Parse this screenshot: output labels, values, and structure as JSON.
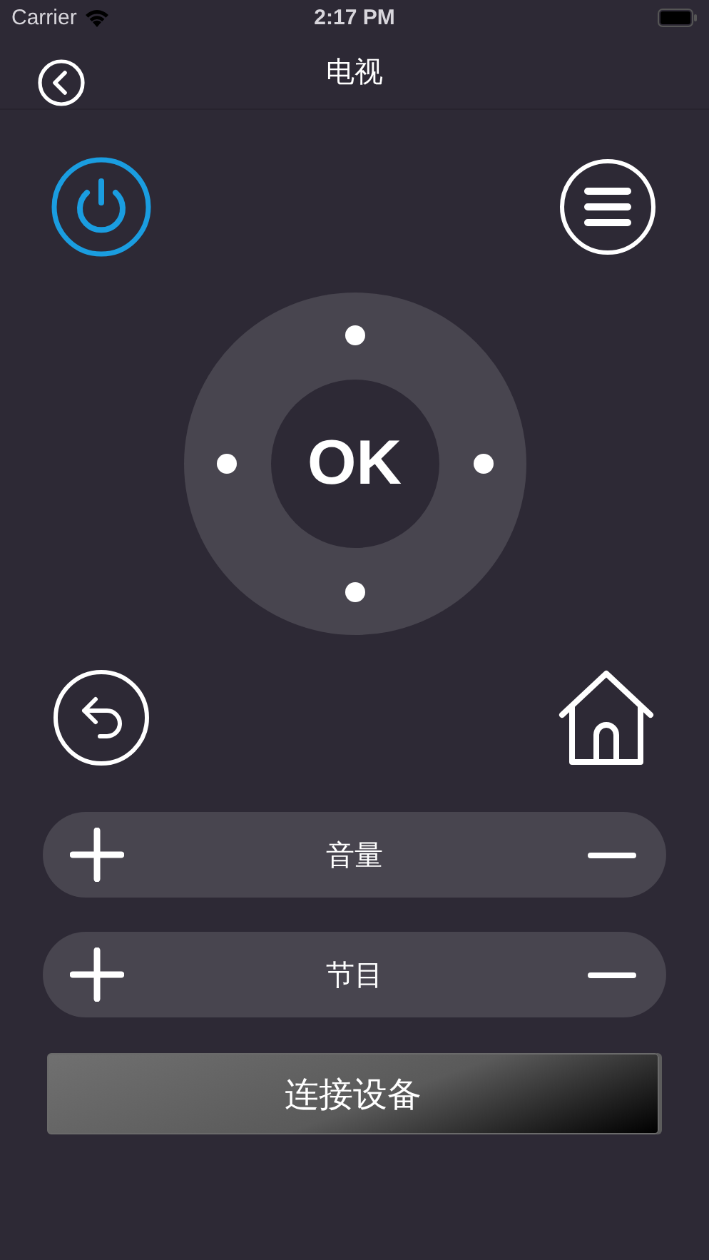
{
  "status_bar": {
    "carrier": "Carrier",
    "time": "2:17 PM"
  },
  "nav_bar": {
    "title": "电视"
  },
  "dpad": {
    "center_label": "OK"
  },
  "rockers": [
    {
      "label": "音量"
    },
    {
      "label": "节目"
    }
  ],
  "connect_button": {
    "label": "连接设备"
  }
}
